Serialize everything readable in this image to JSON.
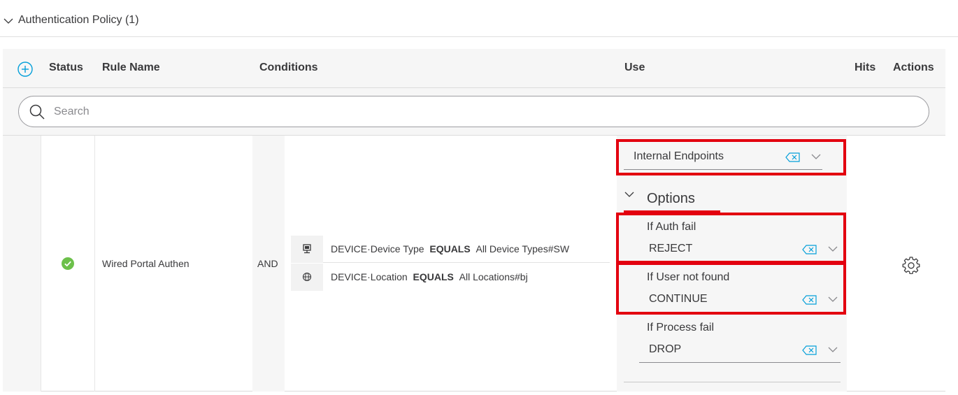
{
  "policy": {
    "title": "Authentication Policy (1)"
  },
  "table": {
    "headers": {
      "status": "Status",
      "rule_name": "Rule Name",
      "conditions": "Conditions",
      "use": "Use",
      "hits": "Hits",
      "actions": "Actions"
    }
  },
  "search": {
    "placeholder": "Search"
  },
  "rule": {
    "name": "Wired Portal Authen",
    "status": "enabled",
    "operator": "AND",
    "conditions": [
      {
        "icon": "device-type-icon",
        "attribute": "DEVICE·Device Type",
        "operator": "EQUALS",
        "value": "All Device Types#SW"
      },
      {
        "icon": "location-icon",
        "attribute": "DEVICE·Location",
        "operator": "EQUALS",
        "value": "All Locations#bj"
      }
    ],
    "use": {
      "identity_source": "Internal Endpoints",
      "options_label": "Options",
      "auth_fail_label": "If Auth fail",
      "auth_fail_value": "REJECT",
      "user_not_found_label": "If User not found",
      "user_not_found_value": "CONTINUE",
      "process_fail_label": "If Process fail",
      "process_fail_value": "DROP"
    }
  },
  "colors": {
    "accent": "#049fd9",
    "success": "#6cc04a",
    "highlight": "#e3000f",
    "header_bg": "#f6f6f6",
    "text": "#39393b"
  }
}
